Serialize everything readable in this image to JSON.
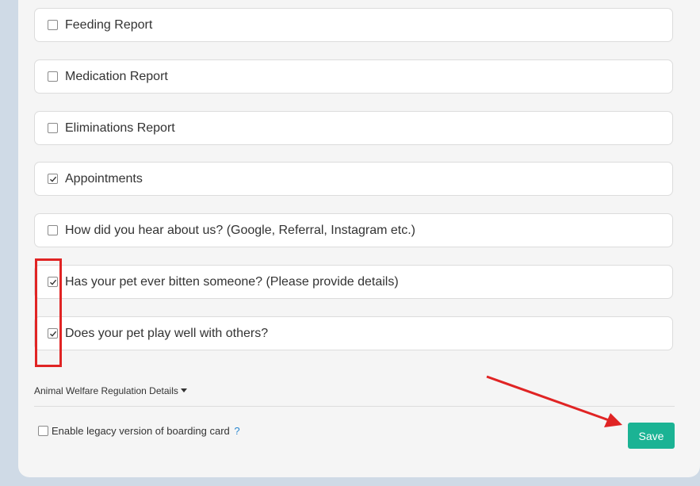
{
  "options": [
    {
      "label": "Feeding Report",
      "checked": false
    },
    {
      "label": "Medication Report",
      "checked": false
    },
    {
      "label": "Eliminations Report",
      "checked": false
    },
    {
      "label": "Appointments",
      "checked": true
    },
    {
      "label": "How did you hear about us? (Google, Referral, Instagram etc.)",
      "checked": false
    },
    {
      "label": "Has your pet ever bitten someone? (Please provide details)",
      "checked": true
    },
    {
      "label": "Does your pet play well with others?",
      "checked": true
    }
  ],
  "details": {
    "label": "Animal Welfare Regulation Details"
  },
  "legacy": {
    "label": "Enable legacy version of boarding card",
    "help": "?",
    "checked": false
  },
  "save": {
    "label": "Save"
  },
  "colors": {
    "accent": "#1bb394",
    "annotation": "#e02424",
    "help_link": "#2a87d0"
  }
}
